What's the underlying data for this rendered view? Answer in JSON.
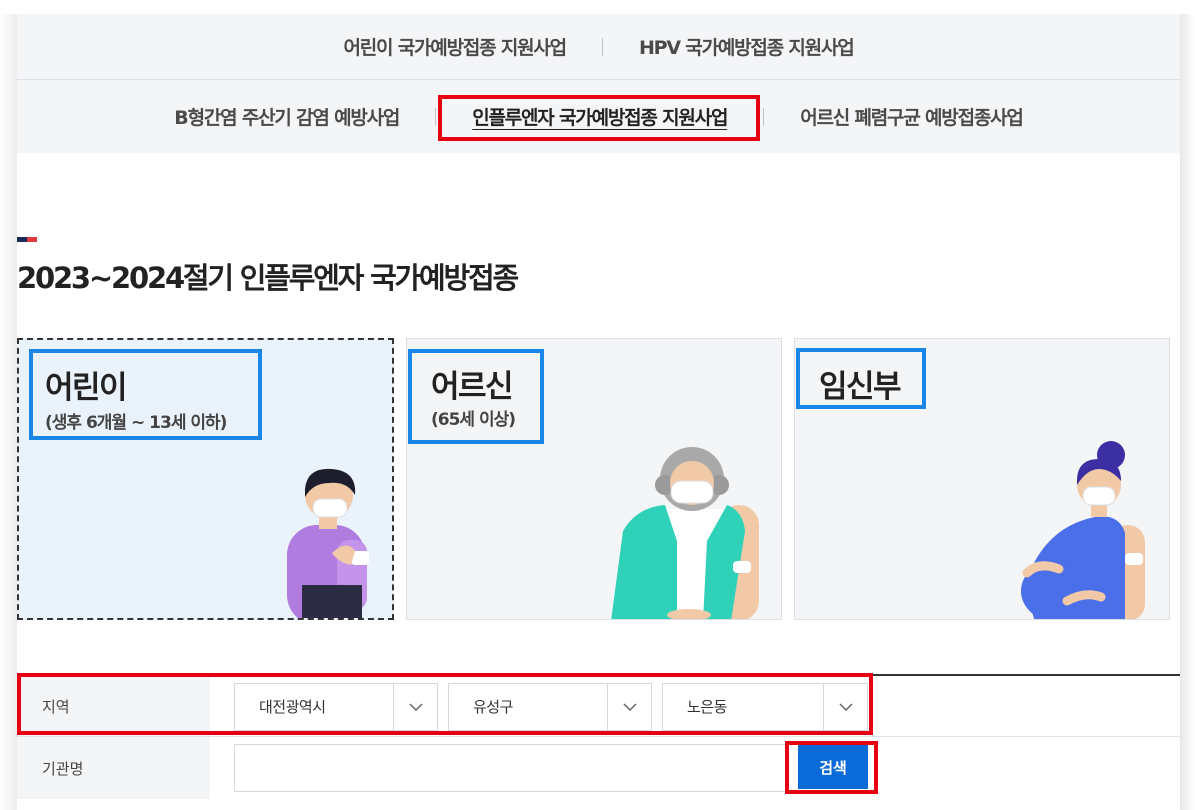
{
  "tabs": {
    "row1": [
      {
        "label": "어린이 국가예방접종 지원사업"
      },
      {
        "label": "HPV 국가예방접종 지원사업"
      }
    ],
    "row2": [
      {
        "label": "B형간염 주산기 감염 예방사업"
      },
      {
        "label": "인플루엔자 국가예방접종 지원사업",
        "active": true
      },
      {
        "label": "어르신 폐렴구균 예방접종사업"
      }
    ]
  },
  "page_title": "2023~2024절기 인플루엔자 국가예방접종",
  "title_mark_colors": [
    "#1a2a57",
    "#e03a3e"
  ],
  "cards": [
    {
      "name": "어린이",
      "sub": "(생후 6개월 ~ 13세 이하)",
      "selected": true,
      "icon": "child-illustration"
    },
    {
      "name": "어르신",
      "sub": "(65세 이상)",
      "selected": false,
      "icon": "elderly-illustration"
    },
    {
      "name": "임신부",
      "sub": "",
      "selected": false,
      "icon": "pregnant-illustration"
    }
  ],
  "search": {
    "region_label": "지역",
    "region_selects": [
      {
        "value": "대전광역시"
      },
      {
        "value": "유성구"
      },
      {
        "value": "노은동"
      }
    ],
    "org_label": "기관명",
    "org_value": "",
    "search_button": "검색"
  },
  "colors": {
    "highlight_red": "#e60012",
    "highlight_blue": "#1a86e8",
    "button_blue": "#0a6bd8",
    "tab_bg": "#f4f5f7"
  }
}
